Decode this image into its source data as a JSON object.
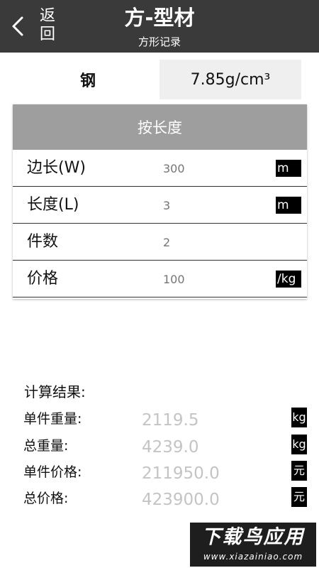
{
  "header": {
    "back_label": "返回",
    "title": "方-型材",
    "subtitle": "方形记录"
  },
  "material": {
    "name": "钢",
    "density": "7.85g/cm³"
  },
  "form": {
    "mode_label": "按长度",
    "rows": [
      {
        "label": "边长(W)",
        "value": "300",
        "unit": "m"
      },
      {
        "label": "长度(L)",
        "value": "3",
        "unit": "m"
      },
      {
        "label": "件数",
        "value": "2",
        "unit": ""
      },
      {
        "label": "价格",
        "value": "100",
        "unit": "/kg"
      }
    ]
  },
  "results": {
    "title": "计算结果:",
    "rows": [
      {
        "label": "单件重量:",
        "value": "2119.5",
        "unit": "kg"
      },
      {
        "label": "总重量:",
        "value": "4239.0",
        "unit": "kg"
      },
      {
        "label": "单件价格:",
        "value": "211950.0",
        "unit": "元"
      },
      {
        "label": "总价格:",
        "value": "423900.0",
        "unit": "元"
      }
    ]
  },
  "watermark": {
    "main": "下载鸟应用",
    "sub": "www.xiazainiao.com"
  },
  "colors": {
    "header_bg": "#3a3a3a",
    "card_head_bg": "#9e9e9e",
    "density_bg": "#efefef",
    "unit_badge_bg": "#000000"
  }
}
